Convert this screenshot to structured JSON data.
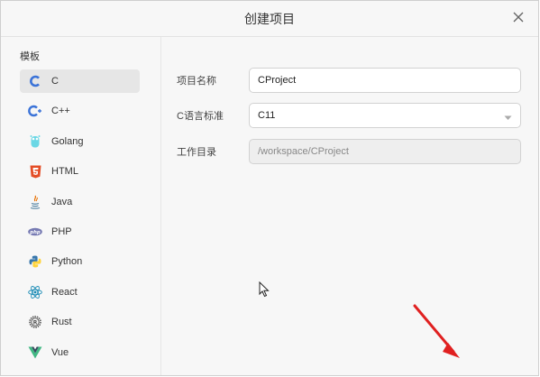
{
  "dialog": {
    "title": "创建项目"
  },
  "sidebar": {
    "heading": "模板",
    "items": [
      {
        "label": "C",
        "icon": "c-icon",
        "active": true
      },
      {
        "label": "C++",
        "icon": "cpp-icon",
        "active": false
      },
      {
        "label": "Golang",
        "icon": "golang-icon",
        "active": false
      },
      {
        "label": "HTML",
        "icon": "html5-icon",
        "active": false
      },
      {
        "label": "Java",
        "icon": "java-icon",
        "active": false
      },
      {
        "label": "PHP",
        "icon": "php-icon",
        "active": false
      },
      {
        "label": "Python",
        "icon": "python-icon",
        "active": false
      },
      {
        "label": "React",
        "icon": "react-icon",
        "active": false
      },
      {
        "label": "Rust",
        "icon": "rust-icon",
        "active": false
      },
      {
        "label": "Vue",
        "icon": "vue-icon",
        "active": false
      }
    ]
  },
  "form": {
    "name_label": "项目名称",
    "name_value": "CProject",
    "standard_label": "C语言标准",
    "standard_value": "C11",
    "dir_label": "工作目录",
    "dir_value": "/workspace/CProject"
  },
  "colors": {
    "accent": "#3b73d8",
    "annotation_arrow": "#e02020"
  }
}
